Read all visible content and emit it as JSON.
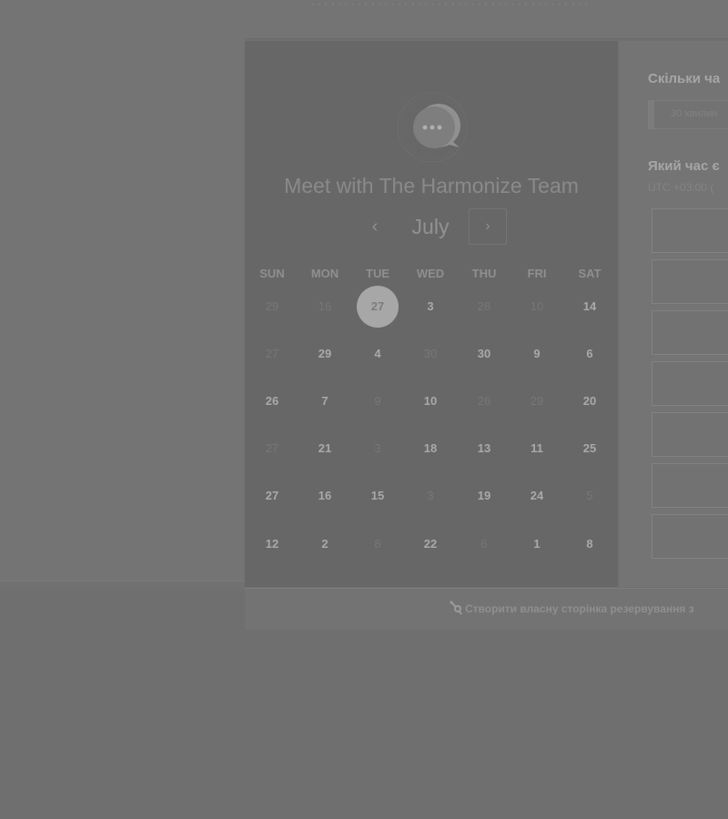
{
  "top_bar": {
    "partial_text": "……………………………………"
  },
  "card": {
    "title": "Meet with The Harmonize Team",
    "month": "July",
    "nav_prev": "‹",
    "nav_next": "›",
    "weekdays": [
      "SUN",
      "MON",
      "TUE",
      "WED",
      "THU",
      "FRI",
      "SAT"
    ],
    "weeks": [
      [
        {
          "t": "29",
          "m": true
        },
        {
          "t": "16",
          "m": true
        },
        {
          "t": "27",
          "s": true
        },
        {
          "t": "3"
        },
        {
          "t": "28",
          "m": true
        },
        {
          "t": "10",
          "m": true
        },
        {
          "t": "14"
        }
      ],
      [
        {
          "t": "27",
          "m": true
        },
        {
          "t": "29"
        },
        {
          "t": "4"
        },
        {
          "t": "30",
          "m": true
        },
        {
          "t": "30"
        },
        {
          "t": "9"
        },
        {
          "t": "6"
        }
      ],
      [
        {
          "t": "26"
        },
        {
          "t": "7"
        },
        {
          "t": "9",
          "m": true
        },
        {
          "t": "10"
        },
        {
          "t": "26",
          "m": true
        },
        {
          "t": "29",
          "m": true
        },
        {
          "t": "20"
        }
      ],
      [
        {
          "t": "27",
          "m": true
        },
        {
          "t": "21"
        },
        {
          "t": "3",
          "m": true
        },
        {
          "t": "18"
        },
        {
          "t": "13"
        },
        {
          "t": "11"
        },
        {
          "t": "25"
        }
      ],
      [
        {
          "t": "27"
        },
        {
          "t": "16"
        },
        {
          "t": "15"
        },
        {
          "t": "3",
          "m": true
        },
        {
          "t": "19"
        },
        {
          "t": "24"
        },
        {
          "t": "5",
          "m": true
        }
      ],
      [
        {
          "t": "12"
        },
        {
          "t": "2"
        },
        {
          "t": "8",
          "m": true
        },
        {
          "t": "22"
        },
        {
          "t": "6",
          "m": true
        },
        {
          "t": "1"
        },
        {
          "t": "8"
        }
      ]
    ]
  },
  "right": {
    "duration_question": "Скільки ча",
    "duration_value": "30 хвилин",
    "time_question": "Який час є",
    "timezone": "UTC +03:00 ("
  },
  "footer": {
    "link_text": "Створити власну сторінка резервування з"
  },
  "colors": {
    "overlay": "#6f6f6f",
    "card": "#676767",
    "selected_day": "#a7a7a7"
  }
}
